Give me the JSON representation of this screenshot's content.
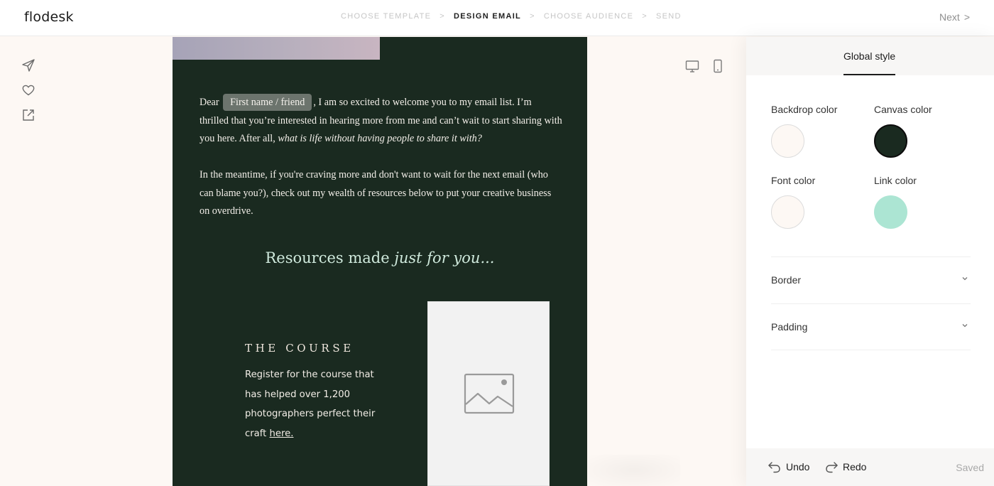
{
  "app": {
    "logo": "flodesk"
  },
  "steps": [
    {
      "label": "CHOOSE TEMPLATE",
      "active": false
    },
    {
      "label": "DESIGN EMAIL",
      "active": true
    },
    {
      "label": "CHOOSE AUDIENCE",
      "active": false
    },
    {
      "label": "SEND",
      "active": false
    }
  ],
  "step_separator": ">",
  "next": {
    "label": "Next",
    "chevron": ">"
  },
  "tools": [
    "send-icon",
    "heart-icon",
    "external-link-icon"
  ],
  "email": {
    "p1": {
      "before": "Dear",
      "merge_tag": "First name / friend",
      "after": ", I am so excited to welcome you to my email list. I’m thrilled that you’re interested in hearing more from me and can’t wait to start sharing with you here. After all,",
      "italic": "what is life without having people to share it with?"
    },
    "p2": "In the meantime, if you're craving more and don't want to wait for the next email (who can blame you?), check out my wealth of resources below to put your creative business on overdrive.",
    "resources": {
      "plain": "Resources made",
      "italic": "just for you..."
    },
    "course": {
      "title": "THE COURSE",
      "text": "Register for the course that has helped over 1,200 photographers perfect their craft",
      "link": "here."
    },
    "image_placeholder": "image-placeholder-icon"
  },
  "view_toggles": [
    "desktop-icon",
    "mobile-icon"
  ],
  "panel": {
    "tab": "Global style",
    "colors": {
      "backdrop": {
        "label": "Backdrop color",
        "value": "#fdf8f4"
      },
      "canvas": {
        "label": "Canvas color",
        "value": "#1a2a20"
      },
      "font": {
        "label": "Font color",
        "value": "#fdf8f4"
      },
      "link": {
        "label": "Link color",
        "value": "#ace5d3"
      }
    },
    "accordions": [
      {
        "label": "Border"
      },
      {
        "label": "Padding"
      }
    ],
    "footer": {
      "undo": "Undo",
      "redo": "Redo",
      "status": "Saved"
    }
  }
}
